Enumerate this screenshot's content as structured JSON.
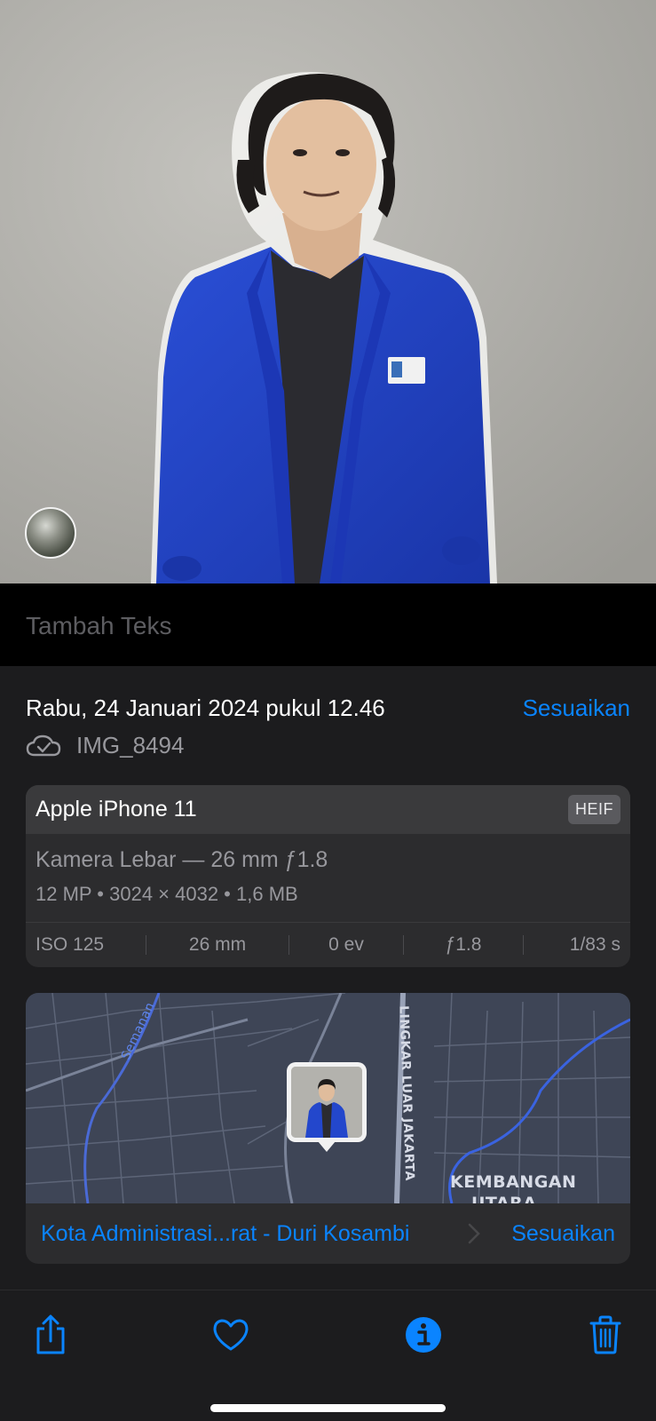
{
  "photo": {
    "subject": "Portrait of person in blue jacket against grey wall"
  },
  "caption": {
    "placeholder": "Tambah Teks"
  },
  "meta": {
    "datetime": "Rabu, 24 Januari 2024 pukul 12.46",
    "adjust_label": "Sesuaikan",
    "filename": "IMG_8494"
  },
  "device": {
    "model": "Apple iPhone 11",
    "format": "HEIF",
    "lens": "Kamera Lebar — 26 mm ƒ1.8",
    "specs": "12 MP  •  3024 × 4032  •  1,6 MB"
  },
  "exif": {
    "iso": "ISO 125",
    "focal": "26 mm",
    "ev": "0 ev",
    "aperture": "ƒ1.8",
    "shutter": "1/83 s"
  },
  "map": {
    "labels": {
      "road_left": "Semanan",
      "road_ring": "LINGKAR LUAR JAKARTA",
      "district_1": "KEMBANGAN",
      "district_2": "UTARA"
    }
  },
  "location": {
    "name": "Kota Administrasi...rat - Duri Kosambi",
    "adjust_label": "Sesuaikan"
  },
  "toolbar": {
    "icons": [
      "share-icon",
      "heart-icon",
      "info-icon",
      "trash-icon"
    ],
    "accent": "#0a84ff"
  }
}
